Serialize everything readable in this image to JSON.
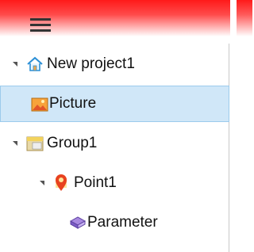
{
  "menu": {
    "icon": "hamburger-menu-icon"
  },
  "tree": {
    "project": {
      "label": "New project1",
      "icon": "house-icon"
    },
    "picture": {
      "label": "Picture",
      "icon": "picture-icon",
      "selected": true
    },
    "group": {
      "label": "Group1",
      "icon": "group-icon"
    },
    "point": {
      "label": "Point1",
      "icon": "map-pin-icon"
    },
    "parameter": {
      "label": "Parameter",
      "icon": "parameter-icon"
    }
  },
  "colors": {
    "header": "#ff1a1a",
    "selection": "#d0e7f8",
    "selection_border": "#9ccbec"
  }
}
